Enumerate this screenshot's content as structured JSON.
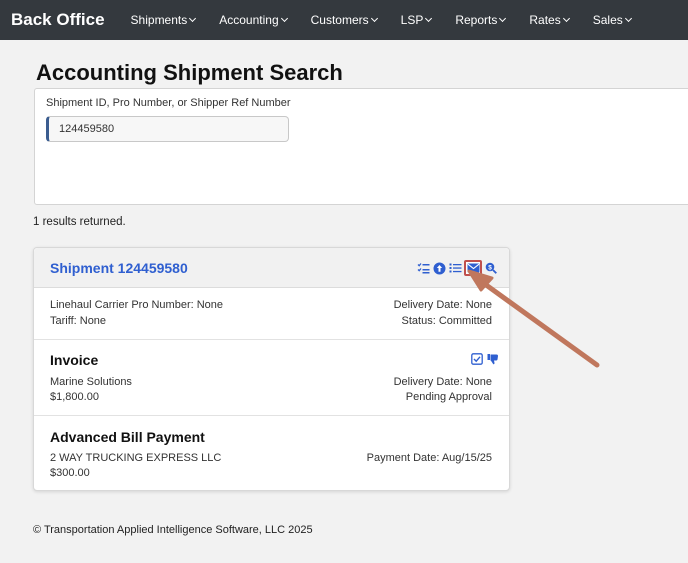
{
  "navbar": {
    "brand": "Back Office",
    "items": [
      {
        "label": "Shipments"
      },
      {
        "label": "Accounting"
      },
      {
        "label": "Customers"
      },
      {
        "label": "LSP"
      },
      {
        "label": "Reports"
      },
      {
        "label": "Rates"
      },
      {
        "label": "Sales"
      }
    ]
  },
  "page": {
    "title": "Accounting Shipment Search"
  },
  "search": {
    "label": "Shipment ID, Pro Number, or Shipper Ref Number",
    "value": "124459580"
  },
  "results": {
    "count_text": "1 results returned."
  },
  "shipment": {
    "title": "Shipment 124459580",
    "header_icons": [
      "checklist-icon",
      "upload-circle-icon",
      "list-icon",
      "envelope-icon",
      "search-dollar-icon"
    ],
    "carrier_pro": "Linehaul Carrier Pro Number: None",
    "tariff": "Tariff: None",
    "delivery_date": "Delivery Date: None",
    "status": "Status: Committed"
  },
  "invoice": {
    "title": "Invoice",
    "icons": [
      "checkbox-icon",
      "thumbs-down-icon"
    ],
    "customer": "Marine Solutions",
    "amount": "$1,800.00",
    "delivery_date": "Delivery Date: None",
    "approval": "Pending Approval"
  },
  "advanced_bill": {
    "title": "Advanced Bill Payment",
    "carrier": "2 WAY TRUCKING EXPRESS LLC",
    "amount": "$300.00",
    "payment_date": "Payment Date: Aug/15/25"
  },
  "footer": {
    "copyright": "© Transportation Applied Intelligence Software, LLC 2025"
  },
  "colors": {
    "navbar": "#34393e",
    "link_blue": "#2f5fd0",
    "annotation_arrow": "#c0775d",
    "highlight_box": "#c0504d"
  }
}
